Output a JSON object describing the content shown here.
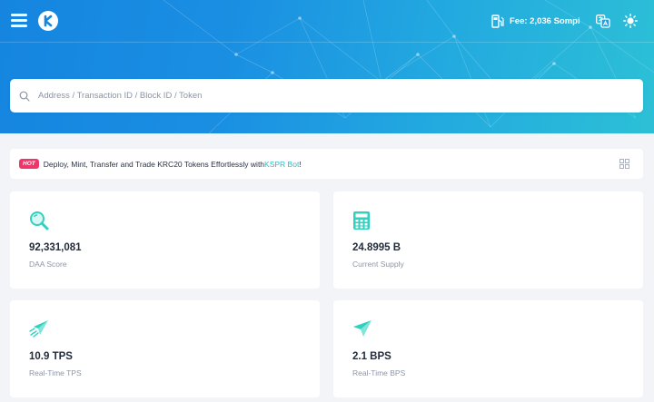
{
  "header": {
    "fee_text": "Fee: 2,036 Sompi",
    "icons": {
      "menu": "menu-icon",
      "logo": "kaspa-logo",
      "fee": "gas-pump-icon",
      "translate": "translate-icon",
      "theme": "sun-icon"
    }
  },
  "search": {
    "placeholder": "Address / Transaction ID / Block ID / Token"
  },
  "banner": {
    "badge": "HOT",
    "text": "Deploy, Mint, Transfer and Trade KRC20 Tokens Effortlessly with ",
    "link": "KSPR Bot",
    "suffix": "!"
  },
  "stats": [
    {
      "value": "92,331,081",
      "label": "DAA Score",
      "icon": "magnifier-icon"
    },
    {
      "value": "24.8995 B",
      "label": "Current Supply",
      "icon": "calculator-icon"
    },
    {
      "value": "10.9 TPS",
      "label": "Real-Time TPS",
      "icon": "fast-plane-icon"
    },
    {
      "value": "2.1 BPS",
      "label": "Real-Time BPS",
      "icon": "paper-plane-icon"
    }
  ],
  "colors": {
    "accent": "#2fd1bf",
    "hero_start": "#1585e0",
    "hero_end": "#2cc0d6",
    "hot": "#f0356b",
    "link": "#2db8c5"
  }
}
